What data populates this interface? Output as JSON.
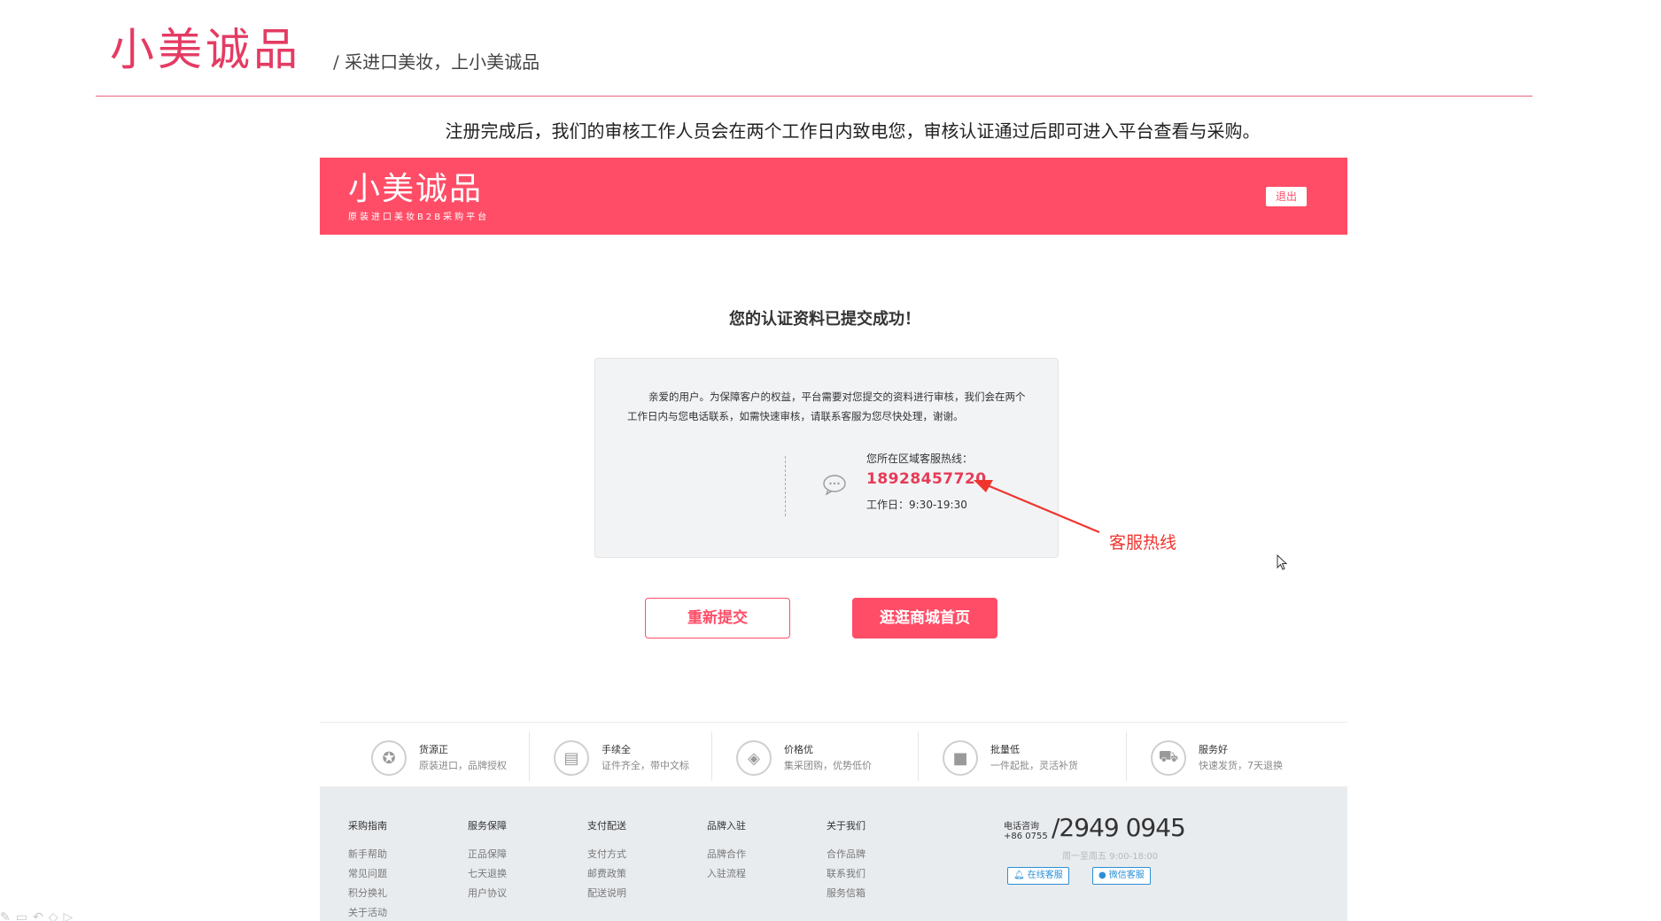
{
  "slide": {
    "logo": "小美诚品",
    "tagline": "/ 采进口美妆，上小美诚品",
    "note": "注册完成后，我们的审核工作人员会在两个工作日内致电您，审核认证通过后即可进入平台查看与采购。"
  },
  "header": {
    "brand_name": "小美诚品",
    "brand_sub": "原装进口美妆B2B采购平台",
    "logout": "退出"
  },
  "main": {
    "success_title": "您的认证资料已提交成功！",
    "message": "亲爱的用户。为保障客户的权益，平台需要对您提交的资料进行审核，我们会在两个工作日内与您电话联系，如需快速审核，请联系客服为您尽快处理，谢谢。",
    "hotline_label": "您所在区域客服热线：",
    "hotline_number": "18928457720",
    "hotline_hours": "工作日：9:30-19:30",
    "resubmit": "重新提交",
    "go_home": "逛逛商城首页"
  },
  "annotation": {
    "label": "客服热线",
    "color": "#f0352f"
  },
  "features": [
    {
      "icon": "seal-icon",
      "title": "货源正",
      "desc": "原装进口，品牌授权"
    },
    {
      "icon": "document-icon",
      "title": "手续全",
      "desc": "证件齐全，带中文标"
    },
    {
      "icon": "tag-icon",
      "title": "价格优",
      "desc": "集采团购，优势低价"
    },
    {
      "icon": "box-icon",
      "title": "批量低",
      "desc": "一件起批，灵活补货"
    },
    {
      "icon": "truck-icon",
      "title": "服务好",
      "desc": "快速发货，7天退换"
    }
  ],
  "footer": {
    "columns": [
      {
        "title": "采购指南",
        "links": [
          "新手帮助",
          "常见问题",
          "积分换礼",
          "关于活动"
        ]
      },
      {
        "title": "服务保障",
        "links": [
          "正品保障",
          "七天退换",
          "用户协议"
        ]
      },
      {
        "title": "支付配送",
        "links": [
          "支付方式",
          "邮费政策",
          "配送说明"
        ]
      },
      {
        "title": "品牌入驻",
        "links": [
          "品牌合作",
          "入驻流程"
        ]
      },
      {
        "title": "关于我们",
        "links": [
          "合作品牌",
          "联系我们",
          "服务信箱"
        ]
      }
    ],
    "phone_label": "电话咨询",
    "phone_prefix": "+86 0755",
    "phone_number": "/2949 0945",
    "phone_hours": "周一至周五 9:00-18:00",
    "online_service": "在线客服",
    "wechat_service": "微信客服"
  },
  "colors": {
    "brand": "#ff4d67",
    "slide_logo": "#e43b63",
    "hotline": "#e63b57",
    "footer_bg": "#e9ecef"
  }
}
